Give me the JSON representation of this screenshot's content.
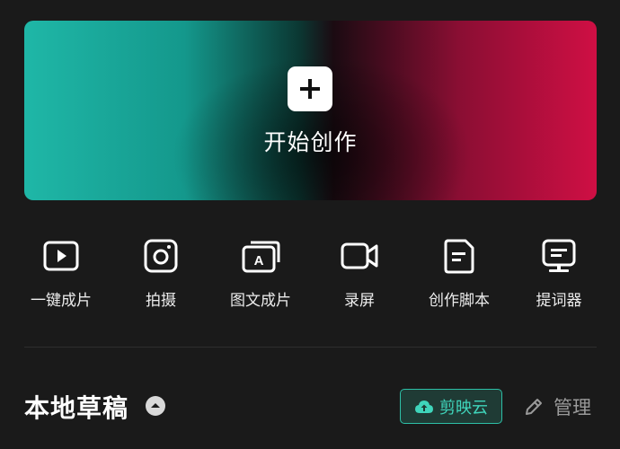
{
  "hero": {
    "title": "开始创作",
    "icon": "plus-icon"
  },
  "tools": [
    {
      "label": "一键成片",
      "icon": "play-icon"
    },
    {
      "label": "拍摄",
      "icon": "camera-icon"
    },
    {
      "label": "图文成片",
      "icon": "text-to-video-icon"
    },
    {
      "label": "录屏",
      "icon": "video-camera-icon"
    },
    {
      "label": "创作脚本",
      "icon": "script-document-icon"
    },
    {
      "label": "提词器",
      "icon": "teleprompter-icon"
    }
  ],
  "drafts": {
    "title": "本地草稿",
    "collapse_icon": "caret-up-icon"
  },
  "actions": {
    "cloud_label": "剪映云",
    "cloud_icon": "cloud-upload-icon",
    "manage_label": "管理",
    "manage_icon": "pencil-icon"
  },
  "colors": {
    "background": "#1a1a1a",
    "gradient_start": "#1fb7a7",
    "gradient_end": "#cf0f44",
    "accent_teal": "#3fd5bb",
    "muted_text": "#9a9a9a"
  }
}
